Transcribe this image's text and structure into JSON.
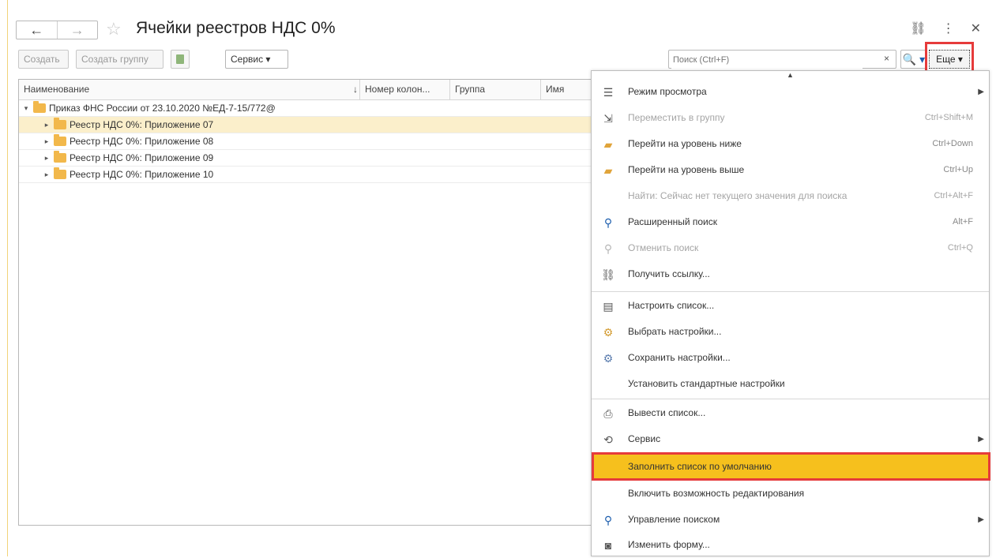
{
  "window": {
    "title": "Ячейки реестров НДС 0%",
    "nav": {
      "back": "←",
      "forward": "→"
    },
    "icons": [
      "link-icon",
      "more-vertical-icon",
      "close-icon"
    ]
  },
  "toolbar": {
    "create": "Создать",
    "create_group": "Создать группу",
    "service": "Сервис ▾",
    "search_placeholder": "Поиск (Ctrl+F)",
    "search_clear": "×",
    "search_button": "🔍 ▾",
    "more": "Еще ▾"
  },
  "table": {
    "columns": [
      "Наименование",
      "Номер колон...",
      "Группа",
      "Имя"
    ],
    "sort_indicator": "↓",
    "rows": [
      {
        "label": "Приказ ФНС России от 23.10.2020 №ЕД-7-15/772@",
        "level": 0,
        "expanded": true
      },
      {
        "label": "Реестр НДС 0%: Приложение 07",
        "level": 1,
        "selected": true
      },
      {
        "label": "Реестр НДС 0%: Приложение 08",
        "level": 1
      },
      {
        "label": "Реестр НДС 0%: Приложение 09",
        "level": 1
      },
      {
        "label": "Реестр НДС 0%: Приложение 10",
        "level": 1
      }
    ]
  },
  "menu": {
    "items": [
      {
        "label": "Режим просмотра",
        "shortcut": "",
        "submenu": true,
        "icon": "view-mode-icon"
      },
      {
        "label": "Переместить в группу",
        "shortcut": "Ctrl+Shift+M",
        "disabled": true,
        "icon": "move-to-group-icon"
      },
      {
        "label": "Перейти на уровень ниже",
        "shortcut": "Ctrl+Down",
        "icon": "level-down-icon"
      },
      {
        "label": "Перейти на уровень выше",
        "shortcut": "Ctrl+Up",
        "icon": "level-up-icon"
      },
      {
        "label": "Найти: Сейчас нет текущего значения для поиска",
        "shortcut": "Ctrl+Alt+F",
        "disabled": true,
        "icon": ""
      },
      {
        "label": "Расширенный поиск",
        "shortcut": "Alt+F",
        "icon": "advanced-search-icon"
      },
      {
        "label": "Отменить поиск",
        "shortcut": "Ctrl+Q",
        "disabled": true,
        "icon": "cancel-search-icon"
      },
      {
        "label": "Получить ссылку...",
        "shortcut": "",
        "icon": "link-icon"
      },
      {
        "label": "Настроить список...",
        "shortcut": "",
        "icon": "configure-list-icon"
      },
      {
        "label": "Выбрать настройки...",
        "shortcut": "",
        "icon": "choose-settings-icon"
      },
      {
        "label": "Сохранить настройки...",
        "shortcut": "",
        "icon": "save-settings-icon"
      },
      {
        "label": "Установить стандартные настройки",
        "shortcut": "",
        "icon": ""
      },
      {
        "label": "Вывести список...",
        "shortcut": "",
        "icon": "print-list-icon"
      },
      {
        "label": "Сервис",
        "shortcut": "",
        "submenu": true,
        "icon": "service-icon"
      },
      {
        "label": "Заполнить список по умолчанию",
        "shortcut": "",
        "highlighted": true,
        "icon": ""
      },
      {
        "label": "Включить возможность редактирования",
        "shortcut": "",
        "icon": ""
      },
      {
        "label": "Управление поиском",
        "shortcut": "",
        "submenu": true,
        "icon": "search-icon"
      },
      {
        "label": "Изменить форму...",
        "shortcut": "",
        "icon": "change-form-icon"
      }
    ]
  }
}
